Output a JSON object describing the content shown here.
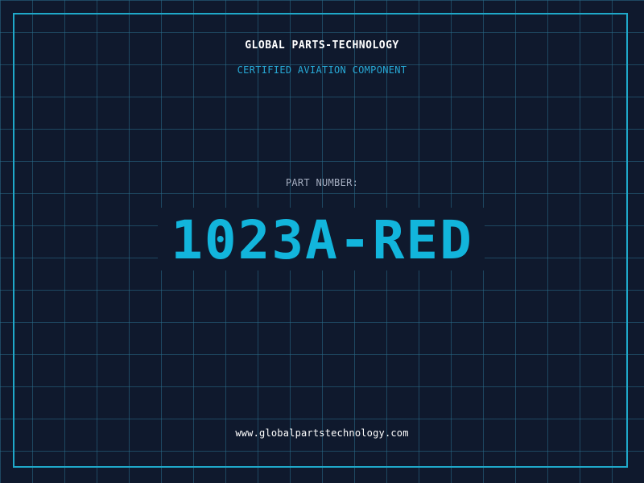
{
  "header": {
    "company": "GLOBAL PARTS-TECHNOLOGY",
    "subtitle": "CERTIFIED AVIATION COMPONENT"
  },
  "part": {
    "label": "PART NUMBER:",
    "number": "1023A-RED"
  },
  "footer": {
    "url": "www.globalpartstechnology.com"
  },
  "colors": {
    "background": "#0f192d",
    "grid": "#296e8c",
    "frame": "#1fa8c9",
    "accent": "#12b5dc",
    "subtitle": "#27a9d6",
    "label": "#a4adc0",
    "text": "#ffffff"
  }
}
